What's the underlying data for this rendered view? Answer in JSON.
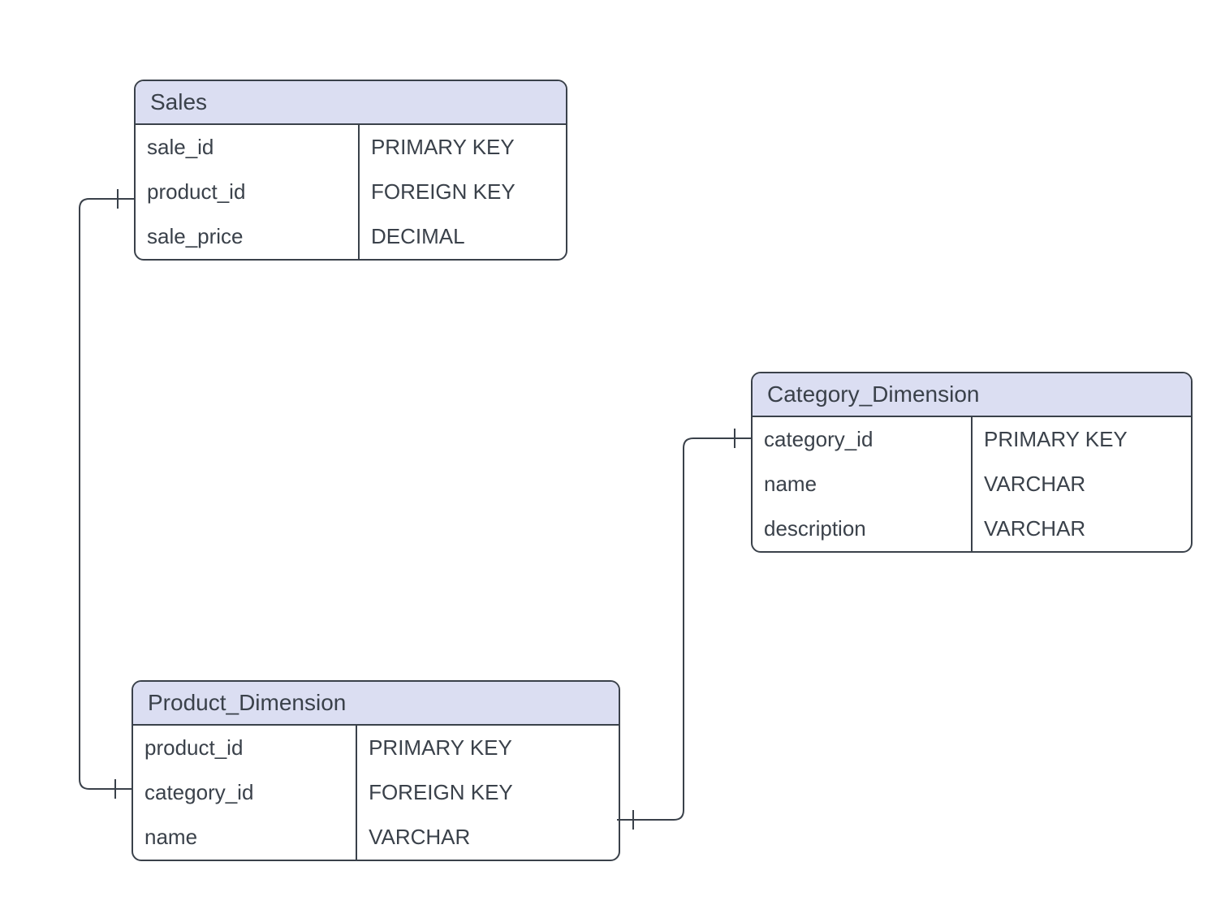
{
  "entities": {
    "sales": {
      "title": "Sales",
      "fields": [
        {
          "name": "sale_id",
          "type": "PRIMARY KEY"
        },
        {
          "name": "product_id",
          "type": "FOREIGN KEY"
        },
        {
          "name": "sale_price",
          "type": "DECIMAL"
        }
      ]
    },
    "category": {
      "title": "Category_Dimension",
      "fields": [
        {
          "name": "category_id",
          "type": "PRIMARY KEY"
        },
        {
          "name": "name",
          "type": "VARCHAR"
        },
        {
          "name": "description",
          "type": "VARCHAR"
        }
      ]
    },
    "product": {
      "title": "Product_Dimension",
      "fields": [
        {
          "name": "product_id",
          "type": "PRIMARY KEY"
        },
        {
          "name": "category_id",
          "type": "FOREIGN KEY"
        },
        {
          "name": "name",
          "type": "VARCHAR"
        }
      ]
    }
  }
}
